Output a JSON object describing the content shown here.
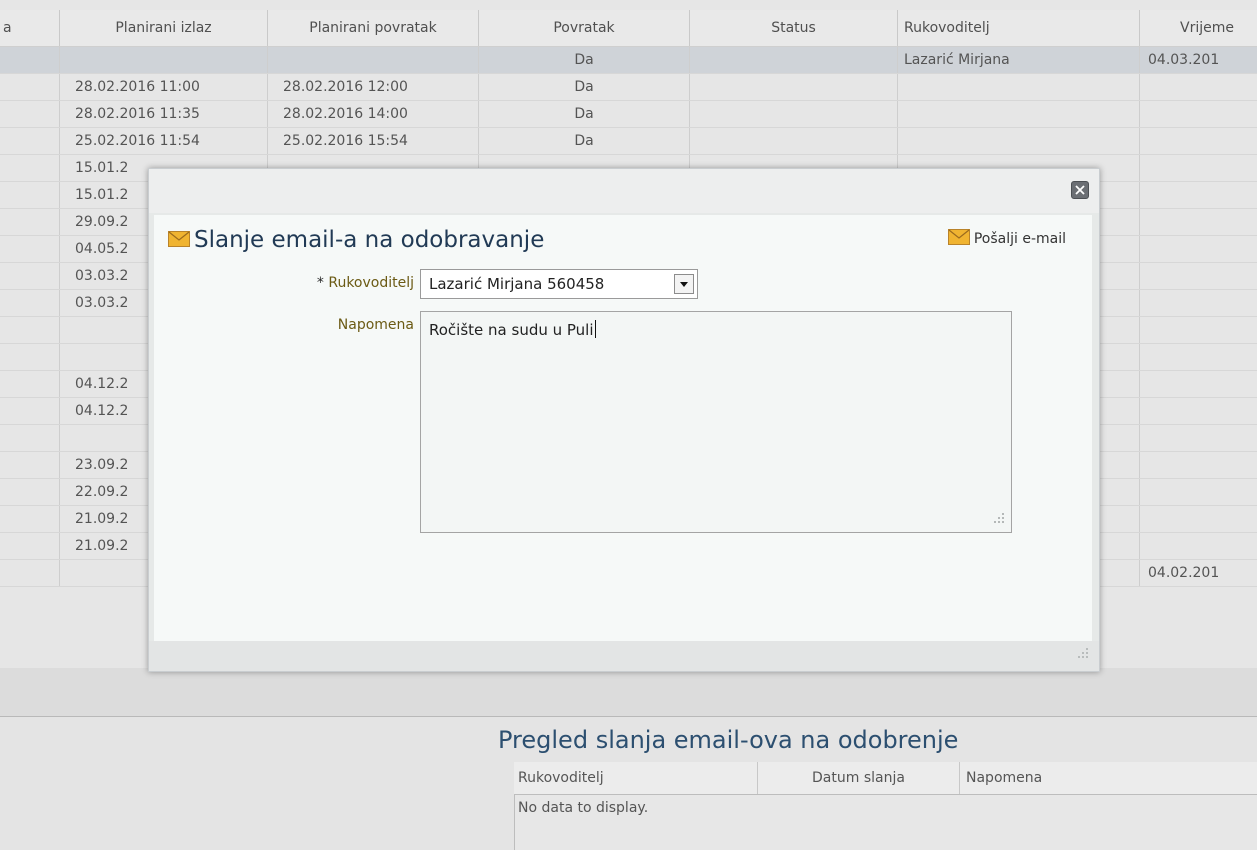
{
  "grid": {
    "columns": [
      {
        "label": "a"
      },
      {
        "label": "Planirani izlaz"
      },
      {
        "label": "Planirani povratak"
      },
      {
        "label": "Povratak"
      },
      {
        "label": "Status"
      },
      {
        "label": "Rukovoditelj"
      },
      {
        "label": "Vrijeme"
      }
    ],
    "rows": [
      [
        "",
        "",
        "",
        "Da",
        "",
        "Lazarić Mirjana",
        "04.03.201"
      ],
      [
        "",
        "28.02.2016 11:00",
        "28.02.2016 12:00",
        "Da",
        "",
        "",
        ""
      ],
      [
        "",
        "28.02.2016 11:35",
        "28.02.2016 14:00",
        "Da",
        "",
        "",
        ""
      ],
      [
        "",
        "25.02.2016 11:54",
        "25.02.2016 15:54",
        "Da",
        "",
        "",
        ""
      ],
      [
        "",
        "15.01.2",
        "",
        "",
        "",
        "",
        ""
      ],
      [
        "",
        "15.01.2",
        "",
        "",
        "",
        "",
        ""
      ],
      [
        "",
        "29.09.2",
        "",
        "",
        "",
        "",
        ""
      ],
      [
        "",
        "04.05.2",
        "",
        "",
        "",
        "",
        ""
      ],
      [
        "",
        "03.03.2",
        "",
        "",
        "",
        "",
        ""
      ],
      [
        "",
        "03.03.2",
        "",
        "",
        "",
        "",
        ""
      ],
      [
        "",
        "",
        "",
        "",
        "",
        "",
        ""
      ],
      [
        "",
        "",
        "",
        "",
        "",
        "",
        ""
      ],
      [
        "",
        "04.12.2",
        "",
        "",
        "",
        "",
        ""
      ],
      [
        "",
        "04.12.2",
        "",
        "",
        "",
        "",
        ""
      ],
      [
        "",
        "",
        "",
        "",
        "",
        "",
        ""
      ],
      [
        "",
        "23.09.2",
        "",
        "",
        "",
        "",
        ""
      ],
      [
        "",
        "22.09.2",
        "",
        "",
        "",
        "",
        ""
      ],
      [
        "",
        "21.09.2",
        "",
        "",
        "",
        "",
        ""
      ],
      [
        "",
        "21.09.2",
        "",
        "",
        "",
        "",
        ""
      ],
      [
        "",
        "",
        "",
        "",
        "",
        "",
        "04.02.201"
      ]
    ]
  },
  "dialog": {
    "title": "Slanje email-a na odobravanje",
    "send_label": "Pošalji e-mail",
    "rukovoditelj_label": "Rukovoditelj",
    "required_marker": "*",
    "rukovoditelj_value": "Lazarić Mirjana 560458",
    "napomena_label": "Napomena",
    "napomena_value": "Ročište na sudu u Puli"
  },
  "pregled": {
    "title": "Pregled slanja email-ova na odobrenje",
    "columns": [
      "Rukovoditelj",
      "Datum slanja",
      "Napomena"
    ],
    "empty_text": "No data to display."
  },
  "colors": {
    "dialog_title": "#213a55",
    "label_gold": "#6b5a14",
    "selected_row": "#cfd3d8",
    "mail_icon": "#f0b431"
  },
  "icons": {
    "close": "close-icon",
    "mail": "mail-icon",
    "dropdown": "chevron-down-icon",
    "resize": "resize-grip-icon"
  }
}
